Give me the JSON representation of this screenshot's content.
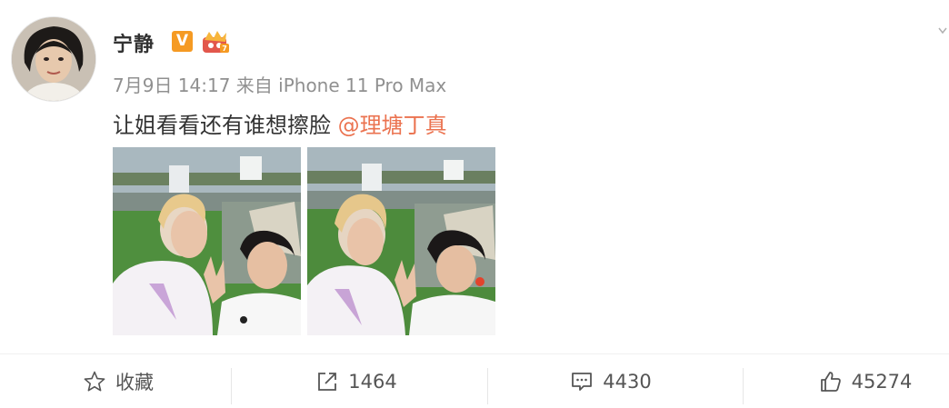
{
  "post": {
    "username": "宁静",
    "verified_badge": "V",
    "member_badge_icon": "crown-badge-icon",
    "meta": "7月9日 14:17 来自 iPhone 11 Pro Max",
    "content_text": "让姐看看还有谁想擦脸 ",
    "mention": "@理塘丁真",
    "images": [
      "selfie-photo",
      "selfie-photo"
    ]
  },
  "actions": {
    "favorite": {
      "label": "收藏",
      "icon": "star-icon"
    },
    "repost": {
      "label": "1464",
      "icon": "share-icon"
    },
    "comment": {
      "label": "4430",
      "icon": "comment-icon"
    },
    "like": {
      "label": "45274",
      "icon": "thumbs-up-icon"
    }
  },
  "colors": {
    "mention": "#eb7350",
    "meta": "#909090",
    "verified": "#f59a23"
  }
}
